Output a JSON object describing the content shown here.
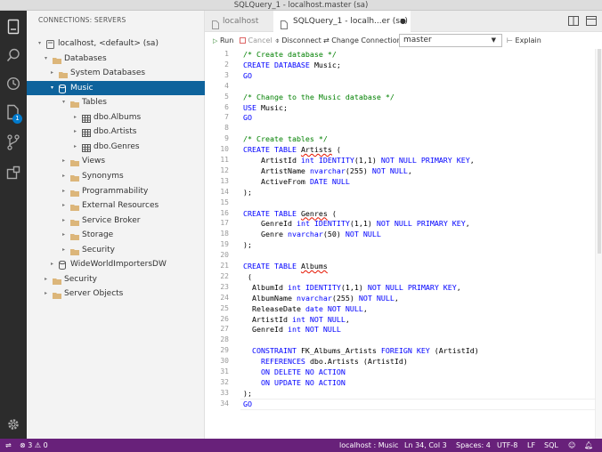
{
  "window": {
    "title": "SQLQuery_1 - localhost.master (sa)"
  },
  "sidebar": {
    "header": "CONNECTIONS: SERVERS",
    "tree": [
      {
        "label": "localhost, <default> (sa)",
        "icon": "server-icon",
        "twisty": "▾",
        "selected": false,
        "level": 0
      },
      {
        "label": "Databases",
        "icon": "folder-icon",
        "twisty": "▾",
        "selected": false,
        "level": 1
      },
      {
        "label": "System Databases",
        "icon": "folder-icon",
        "twisty": "▸",
        "selected": false,
        "level": 2
      },
      {
        "label": "Music",
        "icon": "database-icon",
        "twisty": "▾",
        "selected": true,
        "level": 2
      },
      {
        "label": "Tables",
        "icon": "folder-icon",
        "twisty": "▾",
        "selected": false,
        "level": 3
      },
      {
        "label": "dbo.Albums",
        "icon": "table-icon",
        "twisty": "▸",
        "selected": false,
        "level": 4
      },
      {
        "label": "dbo.Artists",
        "icon": "table-icon",
        "twisty": "▸",
        "selected": false,
        "level": 4
      },
      {
        "label": "dbo.Genres",
        "icon": "table-icon",
        "twisty": "▸",
        "selected": false,
        "level": 4
      },
      {
        "label": "Views",
        "icon": "folder-icon",
        "twisty": "▸",
        "selected": false,
        "level": 3
      },
      {
        "label": "Synonyms",
        "icon": "folder-icon",
        "twisty": "▸",
        "selected": false,
        "level": 3
      },
      {
        "label": "Programmability",
        "icon": "folder-icon",
        "twisty": "▸",
        "selected": false,
        "level": 3
      },
      {
        "label": "External Resources",
        "icon": "folder-icon",
        "twisty": "▸",
        "selected": false,
        "level": 3
      },
      {
        "label": "Service Broker",
        "icon": "folder-icon",
        "twisty": "▸",
        "selected": false,
        "level": 3
      },
      {
        "label": "Storage",
        "icon": "folder-icon",
        "twisty": "▸",
        "selected": false,
        "level": 3
      },
      {
        "label": "Security",
        "icon": "folder-icon",
        "twisty": "▸",
        "selected": false,
        "level": 3
      },
      {
        "label": "WideWorldImportersDW",
        "icon": "database-icon",
        "twisty": "▸",
        "selected": false,
        "level": 2
      },
      {
        "label": "Security",
        "icon": "folder-icon",
        "twisty": "▸",
        "selected": false,
        "level": 1
      },
      {
        "label": "Server Objects",
        "icon": "folder-icon",
        "twisty": "▸",
        "selected": false,
        "level": 1
      }
    ]
  },
  "activity_bar": {
    "badge": "1"
  },
  "tabs": [
    {
      "label": "localhost",
      "active": false
    },
    {
      "label": "SQLQuery_1 - localh...er (sa)",
      "active": true,
      "dirty_marker": "●"
    }
  ],
  "toolbar": {
    "run": "Run",
    "cancel": "Cancel",
    "disconnect": "Disconnect",
    "change_connection": "Change Connection",
    "database": "master",
    "explain": "Explain"
  },
  "editor": {
    "lines": [
      [
        {
          "t": "/* Create database */",
          "c": "cm"
        }
      ],
      [
        {
          "t": "CREATE DATABASE ",
          "c": "kw"
        },
        {
          "t": "Music;",
          "c": ""
        }
      ],
      [
        {
          "t": "GO",
          "c": "kw"
        }
      ],
      [],
      [
        {
          "t": "/* Change to the Music database */",
          "c": "cm"
        }
      ],
      [
        {
          "t": "USE ",
          "c": "kw"
        },
        {
          "t": "Music;",
          "c": ""
        }
      ],
      [
        {
          "t": "GO",
          "c": "kw"
        }
      ],
      [],
      [
        {
          "t": "/* Create tables */",
          "c": "cm"
        }
      ],
      [
        {
          "t": "CREATE TABLE ",
          "c": "kw"
        },
        {
          "t": "Artists",
          "c": "sq"
        },
        {
          "t": " (",
          "c": ""
        }
      ],
      [
        {
          "t": "    ArtistId ",
          "c": ""
        },
        {
          "t": "int IDENTITY",
          "c": "kw"
        },
        {
          "t": "(1,1) ",
          "c": ""
        },
        {
          "t": "NOT NULL PRIMARY KEY",
          "c": "kw"
        },
        {
          "t": ",",
          "c": ""
        }
      ],
      [
        {
          "t": "    ArtistName ",
          "c": ""
        },
        {
          "t": "nvarchar",
          "c": "kw"
        },
        {
          "t": "(255) ",
          "c": ""
        },
        {
          "t": "NOT NULL",
          "c": "kw"
        },
        {
          "t": ",",
          "c": ""
        }
      ],
      [
        {
          "t": "    ActiveFrom ",
          "c": ""
        },
        {
          "t": "DATE NULL",
          "c": "kw"
        }
      ],
      [
        {
          "t": ");",
          "c": ""
        }
      ],
      [],
      [
        {
          "t": "CREATE TABLE ",
          "c": "kw"
        },
        {
          "t": "Genres",
          "c": "sq"
        },
        {
          "t": " (",
          "c": ""
        }
      ],
      [
        {
          "t": "    GenreId ",
          "c": ""
        },
        {
          "t": "int IDENTITY",
          "c": "kw"
        },
        {
          "t": "(1,1) ",
          "c": ""
        },
        {
          "t": "NOT NULL PRIMARY KEY",
          "c": "kw"
        },
        {
          "t": ",",
          "c": ""
        }
      ],
      [
        {
          "t": "    Genre ",
          "c": ""
        },
        {
          "t": "nvarchar",
          "c": "kw"
        },
        {
          "t": "(50) ",
          "c": ""
        },
        {
          "t": "NOT NULL",
          "c": "kw"
        }
      ],
      [
        {
          "t": ");",
          "c": ""
        }
      ],
      [],
      [
        {
          "t": "CREATE TABLE ",
          "c": "kw"
        },
        {
          "t": "Albums",
          "c": "sq"
        }
      ],
      [
        {
          "t": " (",
          "c": ""
        }
      ],
      [
        {
          "t": "  AlbumId ",
          "c": ""
        },
        {
          "t": "int IDENTITY",
          "c": "kw"
        },
        {
          "t": "(1,1) ",
          "c": ""
        },
        {
          "t": "NOT NULL PRIMARY KEY",
          "c": "kw"
        },
        {
          "t": ",",
          "c": ""
        }
      ],
      [
        {
          "t": "  AlbumName ",
          "c": ""
        },
        {
          "t": "nvarchar",
          "c": "kw"
        },
        {
          "t": "(255) ",
          "c": ""
        },
        {
          "t": "NOT NULL",
          "c": "kw"
        },
        {
          "t": ",",
          "c": ""
        }
      ],
      [
        {
          "t": "  ReleaseDate ",
          "c": ""
        },
        {
          "t": "date NOT NULL",
          "c": "kw"
        },
        {
          "t": ",",
          "c": ""
        }
      ],
      [
        {
          "t": "  ArtistId ",
          "c": ""
        },
        {
          "t": "int NOT NULL",
          "c": "kw"
        },
        {
          "t": ",",
          "c": ""
        }
      ],
      [
        {
          "t": "  GenreId ",
          "c": ""
        },
        {
          "t": "int NOT NULL",
          "c": "kw"
        }
      ],
      [],
      [
        {
          "t": "  CONSTRAINT ",
          "c": "kw"
        },
        {
          "t": "FK_Albums_Artists ",
          "c": ""
        },
        {
          "t": "FOREIGN KEY",
          "c": "kw"
        },
        {
          "t": " (ArtistId)",
          "c": ""
        }
      ],
      [
        {
          "t": "    REFERENCES ",
          "c": "kw"
        },
        {
          "t": "dbo.Artists (ArtistId)",
          "c": ""
        }
      ],
      [
        {
          "t": "    ON DELETE NO ACTION",
          "c": "kw"
        }
      ],
      [
        {
          "t": "    ON UPDATE NO ACTION",
          "c": "kw"
        }
      ],
      [
        {
          "t": ");",
          "c": ""
        }
      ],
      [
        {
          "t": "GO",
          "c": "kw"
        }
      ]
    ]
  },
  "statusbar": {
    "errors": "3",
    "warnings": "0",
    "connection": "localhost : Music",
    "position": "Ln 34, Col 3",
    "spaces": "Spaces: 4",
    "encoding": "UTF-8",
    "eol": "LF",
    "language": "SQL"
  },
  "colors": {
    "accent": "#0e639c",
    "status": "#68217a",
    "keyword": "#0000ff",
    "comment": "#008000"
  }
}
